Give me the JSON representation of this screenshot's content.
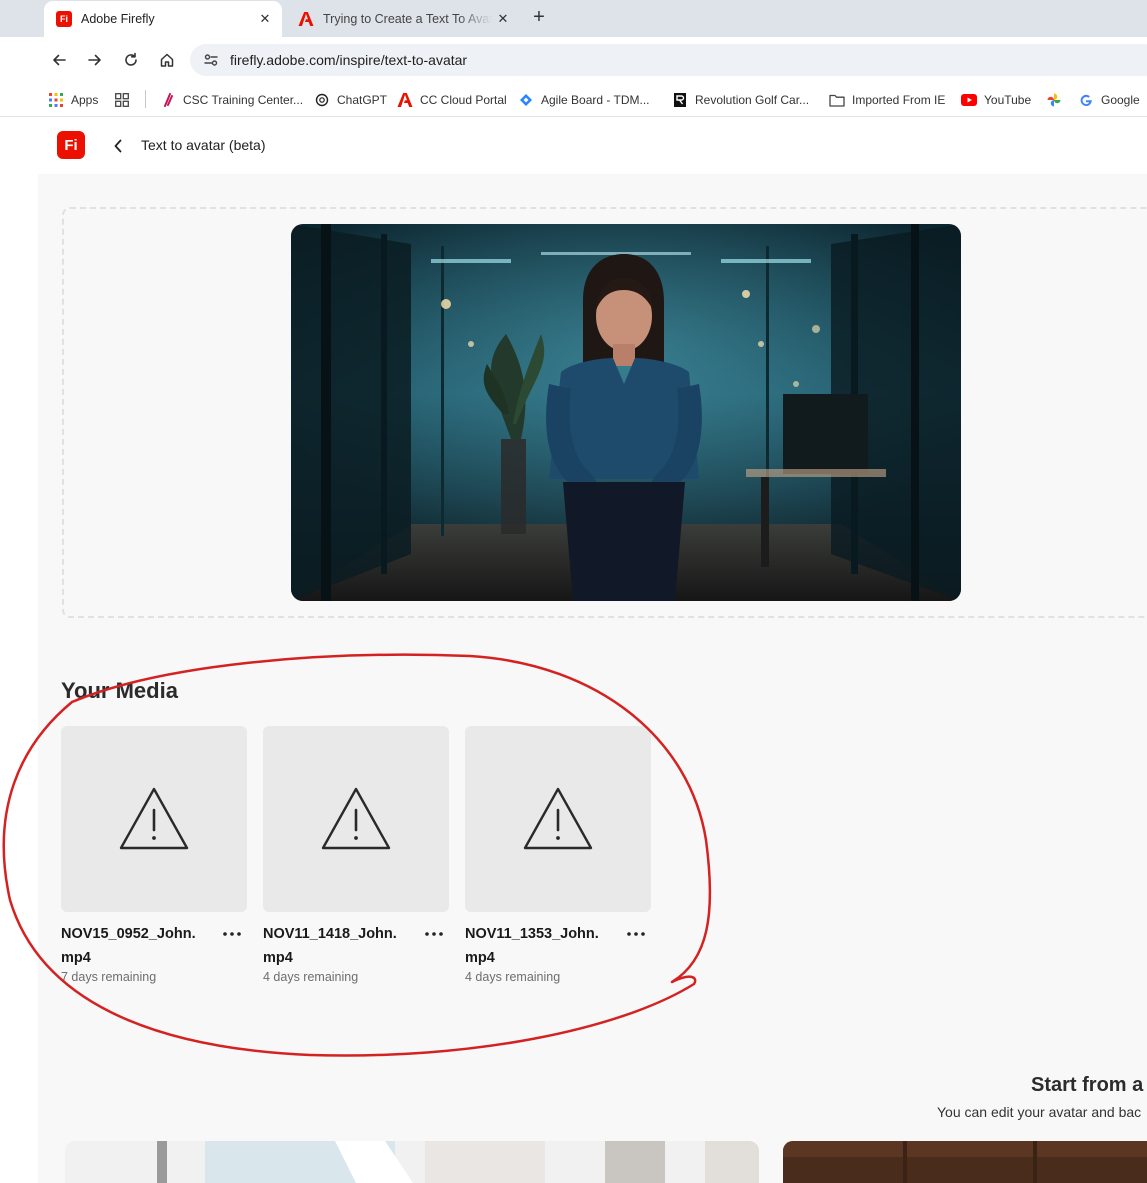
{
  "browser": {
    "tabs": [
      {
        "title": "Adobe Firefly",
        "favicon": "firefly-icon",
        "active": true
      },
      {
        "title": "Trying to Create a Text To Avatar",
        "favicon": "adobe-icon",
        "active": false
      }
    ],
    "address": "firefly.adobe.com/inspire/text-to-avatar",
    "bookmarks": [
      {
        "label": "Apps",
        "icon": "apps-grid-icon"
      },
      {
        "label": "",
        "icon": "tab-groups-icon"
      },
      {
        "label": "CSC Training Center...",
        "icon": "csc-icon"
      },
      {
        "label": "ChatGPT",
        "icon": "chatgpt-icon"
      },
      {
        "label": "CC Cloud Portal",
        "icon": "adobe-icon"
      },
      {
        "label": "Agile Board - TDM...",
        "icon": "jira-icon"
      },
      {
        "label": "Revolution Golf Car...",
        "icon": "revolution-icon"
      },
      {
        "label": "Imported From IE",
        "icon": "folder-icon"
      },
      {
        "label": "YouTube",
        "icon": "youtube-icon"
      },
      {
        "label": "",
        "icon": "photos-icon"
      },
      {
        "label": "Google",
        "icon": "google-icon"
      }
    ]
  },
  "app": {
    "logo": "Fi",
    "page_title": "Text to avatar (beta)",
    "media_section": {
      "title": "Your Media",
      "items": [
        {
          "name": "NOV15_0952_John.\nmp4",
          "remaining": "7 days remaining"
        },
        {
          "name": "NOV11_1418_John.\nmp4",
          "remaining": "4 days remaining"
        },
        {
          "name": "NOV11_1353_John.\nmp4",
          "remaining": "4 days remaining"
        }
      ]
    },
    "start_section": {
      "title": "Start from a",
      "subtitle": "You can edit your avatar and bac"
    }
  },
  "colors": {
    "adobe_red": "#eb1000",
    "annotation_red": "#d42222",
    "page_bg": "#f8f8f8"
  }
}
